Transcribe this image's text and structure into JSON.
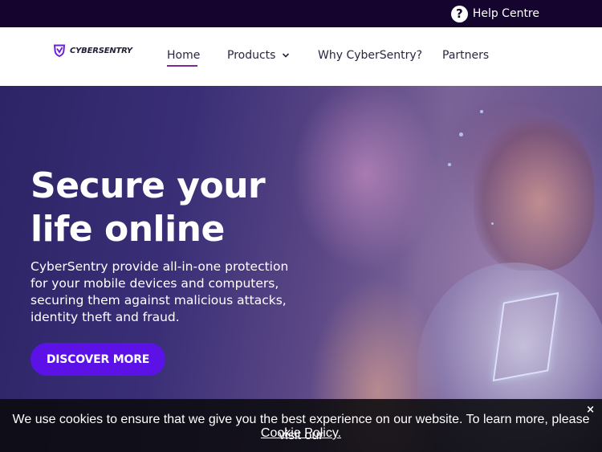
{
  "topbar": {
    "help_label": "Help Centre",
    "help_icon": "question-circle-icon",
    "background": "#15052e"
  },
  "header": {
    "logo_text": "CYBERSENTRY",
    "logo_icon": "shield-icon",
    "nav": {
      "home": "Home",
      "products": "Products",
      "why": "Why CyberSentry?",
      "partners": "Partners"
    },
    "active_underline_color": "#7a2a9c"
  },
  "hero": {
    "title": "Secure your\nlife online",
    "description": "CyberSentry provide all-in-one protection for your mobile devices and computers, securing them against malicious attacks, identity theft and fraud.",
    "cta_label": "DISCOVER MORE",
    "cta_color": "#5c12e6"
  },
  "cookie_banner": {
    "text": "We use cookies to ensure that we give you the best experience on our website. To learn more, please visit our",
    "link_label": "Cookie Policy.",
    "close_label": "×"
  }
}
